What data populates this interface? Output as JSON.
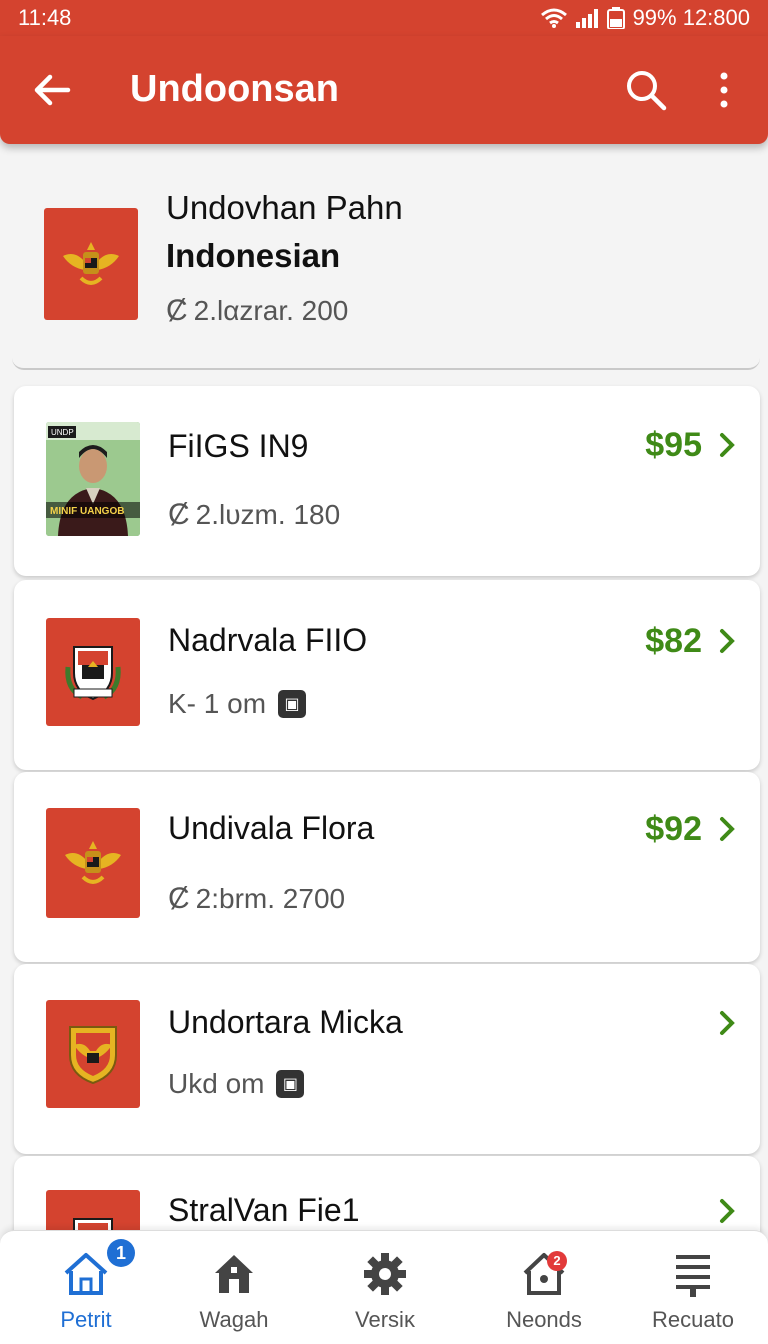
{
  "status_bar": {
    "time": "11:48",
    "right_text": "99% 12:800"
  },
  "app_bar": {
    "title": "Undoonsan"
  },
  "header_item": {
    "title_line1": "Undovhan Pahn",
    "title_line2": "Indonesian",
    "subtitle": "2.lαzrar. 200",
    "icon": "garuda-emblem-icon"
  },
  "items": [
    {
      "title": "FiIGS IN9",
      "subtitle": "2.lυzm. 180",
      "price": "$95",
      "icon": "person-photo",
      "photo_caption": "MINIF UANGOB",
      "photo_tag": "UNDP"
    },
    {
      "title": "Nadrvala FIIO",
      "subtitle": "K- 1 om",
      "price": "$82",
      "icon": "shield-crest-icon"
    },
    {
      "title": "Undivala Flora",
      "subtitle": "2:brm. 2700",
      "price": "$92",
      "icon": "garuda-emblem-icon"
    },
    {
      "title": "Undortara Micka",
      "subtitle": "Ukd om",
      "price": "",
      "icon": "shield-eagle-icon"
    },
    {
      "title": "StralVan Fie1",
      "subtitle": "",
      "price": "",
      "icon": "shield-crest-icon"
    }
  ],
  "bottom_nav": [
    {
      "label": "Petrit",
      "icon": "home-icon",
      "badge": "1",
      "active": true
    },
    {
      "label": "Wagah",
      "icon": "house-icon",
      "badge": "",
      "active": false
    },
    {
      "label": "Versiĸ",
      "icon": "gear-icon",
      "badge": "",
      "active": false
    },
    {
      "label": "Neonds",
      "icon": "notification-house-icon",
      "badge": "2",
      "active": false
    },
    {
      "label": "Recuato",
      "icon": "menu-lines-icon",
      "badge": "",
      "active": false
    }
  ],
  "colors": {
    "primary": "#d4432f",
    "price": "#3f8a17",
    "active_nav": "#1f6fd4"
  }
}
